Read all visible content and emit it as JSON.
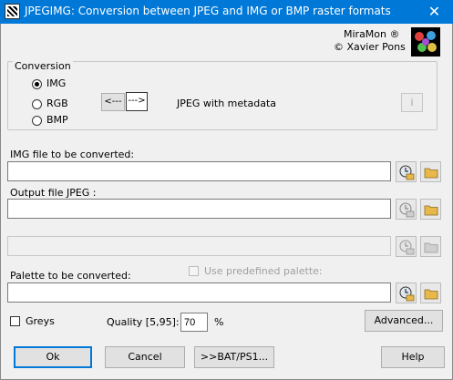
{
  "window": {
    "title": "JPEGIMG: Conversion between JPEG and IMG or BMP raster formats",
    "close_glyph": "✕",
    "icon": "app-icon"
  },
  "brand": {
    "line1": "MiraMon ®",
    "line2": "© Xavier Pons"
  },
  "conversion": {
    "label": "Conversion",
    "options": [
      "IMG",
      "RGB",
      "BMP"
    ],
    "selected": "IMG",
    "left_arrow": "<---",
    "right_arrow": "--->",
    "target": "JPEG with metadata",
    "info_label": "i"
  },
  "img_file": {
    "label": "IMG file to be converted:",
    "value": ""
  },
  "output_file": {
    "label": "Output file JPEG :",
    "value": ""
  },
  "extra_field": {
    "value": ""
  },
  "palette": {
    "label": "Palette to be converted:",
    "value": "",
    "predefined_label": "Use predefined palette:",
    "predefined_checked": false
  },
  "options": {
    "greys_label": "Greys",
    "greys_checked": false,
    "quality_label": "Quality [5,95]:",
    "quality_value": "70",
    "quality_unit": "%",
    "advanced_label": "Advanced..."
  },
  "buttons": {
    "ok": "Ok",
    "cancel": "Cancel",
    "bat": ">>BAT/PS1...",
    "help": "Help"
  },
  "colors": {
    "titlebar": "#0078d7",
    "folder": "#e8b84a"
  }
}
